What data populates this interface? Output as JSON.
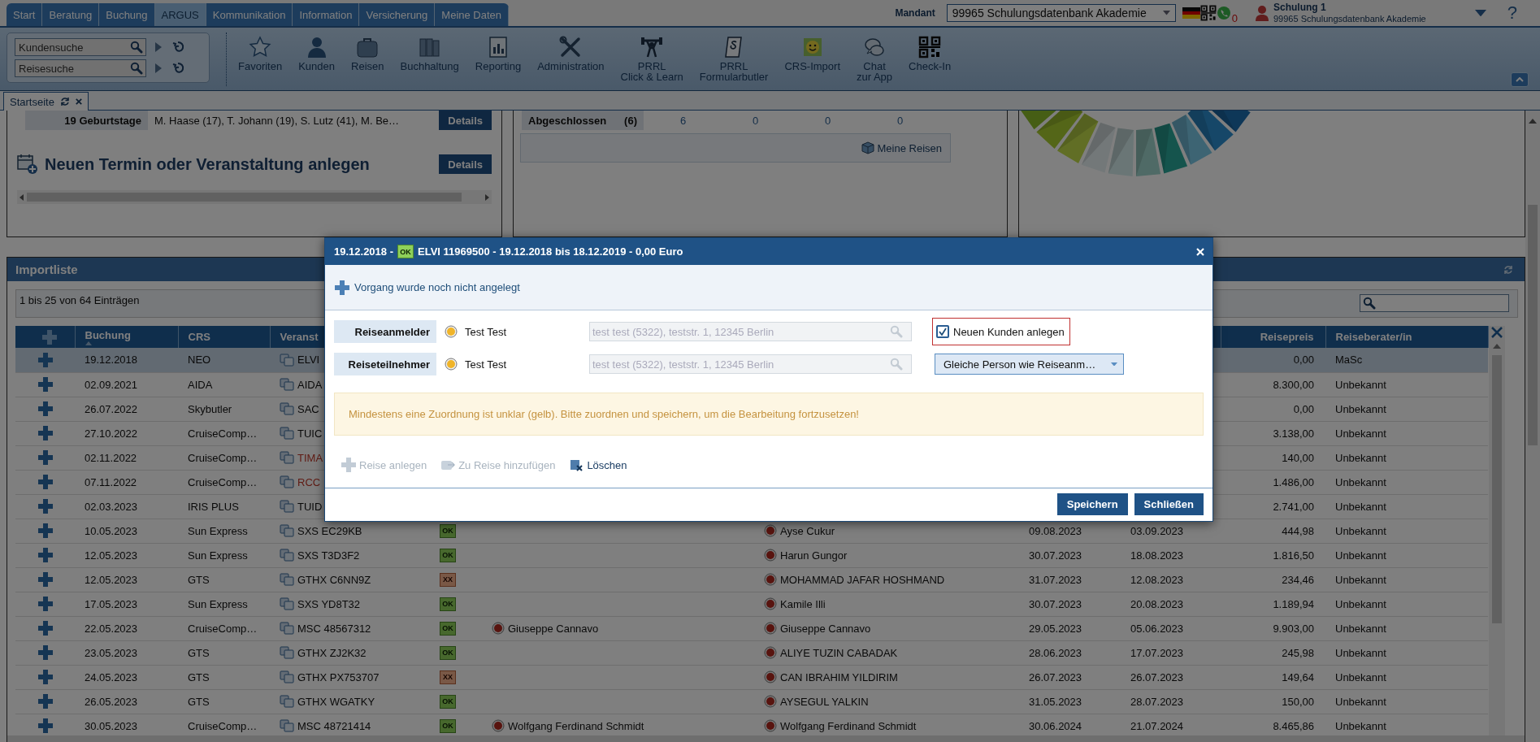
{
  "nav": {
    "tabs": [
      {
        "label": "Start",
        "selected": false
      },
      {
        "label": "Beratung",
        "selected": false
      },
      {
        "label": "Buchung",
        "selected": false
      },
      {
        "label": "ARGUS",
        "selected": true
      },
      {
        "label": "Kommunikation",
        "selected": false
      },
      {
        "label": "Information",
        "selected": false
      },
      {
        "label": "Versicherung",
        "selected": false
      },
      {
        "label": "Meine Daten",
        "selected": false
      }
    ],
    "mandant_label": "Mandant",
    "mandant_value": "99965 Schulungsdatenbank Akademie",
    "notification_count": "0",
    "user_name": "Schulung 1",
    "user_org": "99965 Schulungsdatenbank Akademie",
    "help": "?"
  },
  "toolbar": {
    "searches": [
      {
        "placeholder": "Kundensuche"
      },
      {
        "placeholder": "Reisesuche"
      }
    ],
    "buttons": [
      {
        "label": "Favoriten",
        "kind": "star"
      },
      {
        "label": "Kunden",
        "kind": "person"
      },
      {
        "label": "Reisen",
        "kind": "suitcase"
      },
      {
        "label": "Buchhaltung",
        "kind": "binders"
      },
      {
        "label": "Reporting",
        "kind": "report"
      },
      {
        "label": "Administration",
        "kind": "tools"
      },
      {
        "label": "PRRL\nClick & Learn",
        "kind": "lifter"
      },
      {
        "label": "PRRL\nFormularbutler",
        "kind": "paragraph"
      },
      {
        "label": "CRS-Import",
        "kind": "smiley"
      },
      {
        "label": "Chat\nzur App",
        "kind": "chat"
      },
      {
        "label": "Check-In",
        "kind": "qr"
      }
    ]
  },
  "page_tabs": [
    {
      "label": "Startseite",
      "selected": true
    }
  ],
  "birthdays": {
    "label": "19 Geburtstage",
    "names": "M. Haase (17), T. Johann (19), S. Lutz (41), M. Be…",
    "button": "Details"
  },
  "new_event": {
    "title": "Neuen Termin oder Veranstaltung anlegen",
    "button": "Details"
  },
  "trips_summary": {
    "label": "Abgeschlossen",
    "count": "(6)",
    "values": [
      "6",
      "0",
      "0",
      "0"
    ],
    "button": "Meine Reisen"
  },
  "import_list": {
    "title": "Importliste",
    "summary": "1 bis 25 von 64 Einträgen",
    "columns": [
      {
        "label": "Buchung",
        "sorted": true
      },
      {
        "label": "CRS",
        "sorted": false
      },
      {
        "label": "Veranst",
        "sorted": false
      },
      {
        "label": "Reisepreis",
        "sorted": false
      },
      {
        "label": "Reiseberater/in",
        "sorted": false
      }
    ],
    "rows": [
      {
        "buchung": "19.12.2018",
        "crs": "NEO",
        "veranstalter": "ELVI",
        "flagged": false,
        "preis": "0,00",
        "berater": "MaSc",
        "selected": true
      },
      {
        "buchung": "02.09.2021",
        "crs": "AIDA",
        "veranstalter": "AIDA",
        "flagged": false,
        "preis": "8.300,00",
        "berater": "Unbekannt",
        "selected": false
      },
      {
        "buchung": "26.07.2022",
        "crs": "Skybutler",
        "veranstalter": "SAC",
        "flagged": false,
        "preis": "0,00",
        "berater": "Unbekannt",
        "selected": false
      },
      {
        "buchung": "27.10.2022",
        "crs": "CruiseComp…",
        "veranstalter": "TUIC",
        "flagged": false,
        "preis": "3.138,00",
        "berater": "Unbekannt",
        "selected": false
      },
      {
        "buchung": "02.11.2022",
        "crs": "CruiseComp…",
        "veranstalter": "TIMA",
        "flagged": true,
        "preis": "140,00",
        "berater": "Unbekannt",
        "selected": false
      },
      {
        "buchung": "07.11.2022",
        "crs": "CruiseComp…",
        "veranstalter": "RCC",
        "flagged": true,
        "preis": "1.486,00",
        "berater": "Unbekannt",
        "selected": false
      },
      {
        "buchung": "02.03.2023",
        "crs": "IRIS PLUS",
        "veranstalter": "TUID",
        "flagged": false,
        "preis": "2.741,00",
        "berater": "Unbekannt",
        "selected": false
      },
      {
        "buchung": "10.05.2023",
        "crs": "Sun Express",
        "veranstalter": "SXS EC29KB",
        "flagged": false,
        "status": {
          "label": "OK",
          "kind": "ok"
        },
        "teilnehmer": "Ayse Cukur",
        "von": "09.08.2023",
        "bis": "03.09.2023",
        "preis": "444,98",
        "berater": "Unbekannt",
        "selected": false
      },
      {
        "buchung": "12.05.2023",
        "crs": "Sun Express",
        "veranstalter": "SXS T3D3F2",
        "flagged": false,
        "status": {
          "label": "OK",
          "kind": "ok"
        },
        "teilnehmer": "Harun Gungor",
        "von": "30.07.2023",
        "bis": "18.08.2023",
        "preis": "1.816,50",
        "berater": "Unbekannt",
        "selected": false
      },
      {
        "buchung": "12.05.2023",
        "crs": "GTS",
        "veranstalter": "GTHX C6NN9Z",
        "flagged": false,
        "status": {
          "label": "XX",
          "kind": "error"
        },
        "teilnehmer": "MOHAMMAD JAFAR HOSHMAND",
        "von": "31.07.2023",
        "bis": "12.08.2023",
        "preis": "234,46",
        "berater": "Unbekannt",
        "selected": false
      },
      {
        "buchung": "17.05.2023",
        "crs": "Sun Express",
        "veranstalter": "SXS YD8T32",
        "flagged": false,
        "status": {
          "label": "OK",
          "kind": "ok"
        },
        "teilnehmer": "Kamile Illi",
        "von": "30.07.2023",
        "bis": "20.08.2023",
        "preis": "1.189,94",
        "berater": "Unbekannt",
        "selected": false
      },
      {
        "buchung": "22.05.2023",
        "crs": "CruiseComp…",
        "veranstalter": "MSC 48567312",
        "flagged": false,
        "status": {
          "label": "OK",
          "kind": "ok"
        },
        "anmelder": "Giuseppe Cannavo",
        "teilnehmer": "Giuseppe Cannavo",
        "von": "29.05.2023",
        "bis": "05.06.2023",
        "preis": "9.903,00",
        "berater": "Unbekannt",
        "selected": false
      },
      {
        "buchung": "23.05.2023",
        "crs": "GTS",
        "veranstalter": "GTHX ZJ2K32",
        "flagged": false,
        "status": {
          "label": "OK",
          "kind": "ok"
        },
        "teilnehmer": "ALIYE TUZIN CABADAK",
        "von": "28.06.2023",
        "bis": "17.07.2023",
        "preis": "245,98",
        "berater": "Unbekannt",
        "selected": false
      },
      {
        "buchung": "24.05.2023",
        "crs": "GTS",
        "veranstalter": "GTHX PX753707",
        "flagged": false,
        "status": {
          "label": "XX",
          "kind": "error"
        },
        "teilnehmer": "CAN IBRAHIM YILDIRIM",
        "von": "26.07.2023",
        "bis": "26.07.2023",
        "preis": "149,64",
        "berater": "Unbekannt",
        "selected": false
      },
      {
        "buchung": "26.05.2023",
        "crs": "GTS",
        "veranstalter": "GTHX WGATKY",
        "flagged": false,
        "status": {
          "label": "OK",
          "kind": "ok"
        },
        "teilnehmer": "AYSEGUL YALKIN",
        "von": "31.05.2023",
        "bis": "28.07.2023",
        "preis": "150,00",
        "berater": "Unbekannt",
        "selected": false
      },
      {
        "buchung": "30.05.2023",
        "crs": "CruiseComp…",
        "veranstalter": "MSC 48721414",
        "flagged": false,
        "status": {
          "label": "OK",
          "kind": "ok"
        },
        "anmelder": "Wolfgang Ferdinand Schmidt",
        "teilnehmer": "Wolfgang Ferdinand Schmidt",
        "von": "30.06.2024",
        "bis": "21.07.2024",
        "preis": "8.465,86",
        "berater": "Unbekannt",
        "selected": false
      }
    ]
  },
  "dialog": {
    "title_date": "19.12.2018 -",
    "title_status": {
      "label": "OK",
      "kind": "ok"
    },
    "title_text": "ELVI 11969500 - 19.12.2018 bis 18.12.2019 - 0,00 Euro",
    "notice": "Vorgang wurde noch nicht angelegt",
    "people": [
      {
        "role": "Reiseanmelder",
        "name": "Test Test",
        "match": "test test (5322), teststr. 1, 12345 Berlin"
      },
      {
        "role": "Reiseteilnehmer",
        "name": "Test Test",
        "match": "test test (5322), teststr. 1, 12345 Berlin"
      }
    ],
    "new_customer": {
      "label": "Neuen Kunden anlegen",
      "checked": true
    },
    "participant_select": "Gleiche Person wie Reiseanm…",
    "warning": "Mindestens eine Zuordnung ist unklar (gelb). Bitte zuordnen und speichern, um die Bearbeitung fortzusetzen!",
    "actions": [
      {
        "label": "Reise anlegen",
        "kind": "add",
        "disabled": true
      },
      {
        "label": "Zu Reise hinzufügen",
        "kind": "attach",
        "disabled": true
      },
      {
        "label": "Löschen",
        "kind": "delete",
        "disabled": false
      }
    ],
    "buttons": [
      "Speichern",
      "Schließen"
    ]
  }
}
